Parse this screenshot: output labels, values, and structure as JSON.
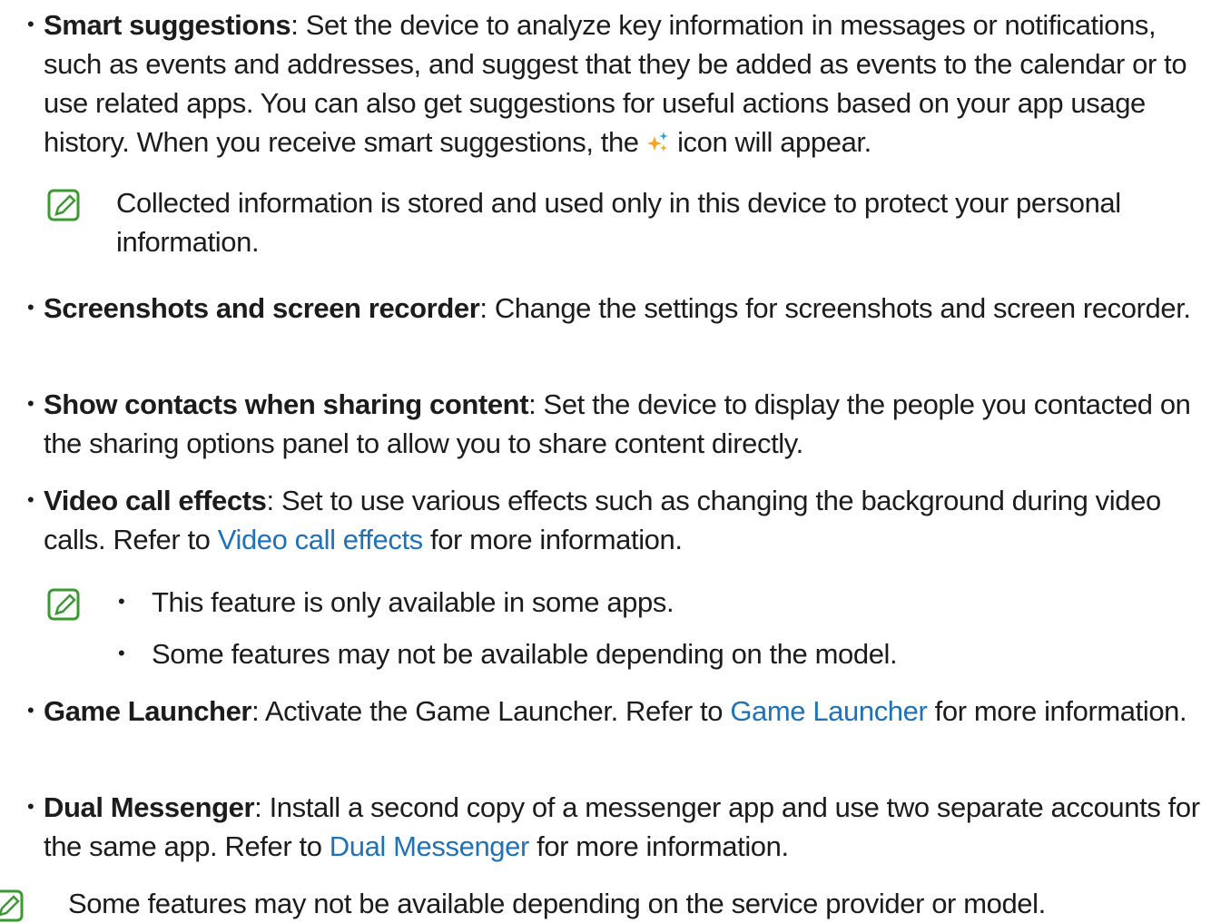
{
  "items": [
    {
      "title": "Smart suggestions",
      "text_before_icon": ": Set the device to analyze key information in messages or notifications, such as events and addresses, and suggest that they be added as events to the calendar or to use related apps. You can also get suggestions for useful actions based on your app usage history. When you receive smart suggestions, the ",
      "text_after_icon": " icon will appear.",
      "icon": "sparkle-icon",
      "note": "Collected information is stored and used only in this device to protect your personal information."
    },
    {
      "title": "Screenshots and screen recorder",
      "text": ": Change the settings for screenshots and screen recorder."
    },
    {
      "title": "Show contacts when sharing content",
      "text": ": Set the device to display the people you contacted on the sharing options panel to allow you to share content directly."
    },
    {
      "title": "Video call effects",
      "text_before_link": ": Set to use various effects such as changing the background during video calls. Refer to ",
      "link": "Video call effects",
      "text_after_link": " for more information.",
      "notes": [
        "This feature is only available in some apps.",
        "Some features may not be available depending on the model."
      ]
    },
    {
      "title": "Game Launcher",
      "text_before_link": ": Activate the Game Launcher. Refer to ",
      "link": "Game Launcher",
      "text_after_link": " for more information."
    },
    {
      "title": "Dual Messenger",
      "text_before_link": ": Install a second copy of a messenger app and use two separate accounts for the same app. Refer to ",
      "link": "Dual Messenger",
      "text_after_link": " for more information."
    }
  ],
  "footer_note": "Some features may not be available depending on the service provider or model.",
  "bullet_glyph": "•",
  "colors": {
    "link": "#1f72b8",
    "note_icon": "#3a9a2f",
    "sparkle": "#f5a623"
  }
}
